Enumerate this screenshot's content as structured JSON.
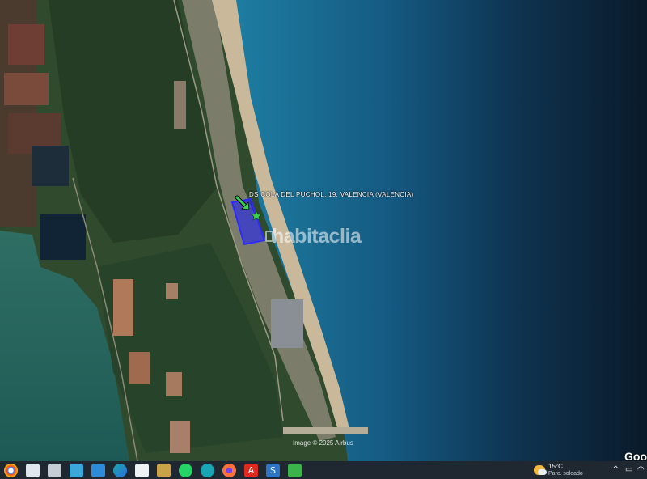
{
  "map": {
    "parcel_label": "DS COLA DEL PUCHOL, 19. VALENCIA (VALENCIA)",
    "watermark": "habitaclia",
    "credit": "Image © 2025 Airbus",
    "provider": "Goo"
  },
  "marker": {
    "icon": "arrow-marker-icon",
    "color": "#39d353"
  },
  "parcel_color": "#1a1aff",
  "taskbar": {
    "apps": [
      {
        "name": "chrome-icon",
        "color": "#e94235"
      },
      {
        "name": "file-manager-icon",
        "color": "#f0c43c"
      },
      {
        "name": "window-icon",
        "color": "#4a90d9"
      },
      {
        "name": "network-icon",
        "color": "#3aa8d8"
      },
      {
        "name": "photos-icon",
        "color": "#2e8bd8"
      },
      {
        "name": "edge-icon",
        "color": "#1aa5a5"
      },
      {
        "name": "document-icon",
        "color": "#d7dde3"
      },
      {
        "name": "archive-icon",
        "color": "#c9a24a"
      },
      {
        "name": "whatsapp-icon",
        "color": "#25d366"
      },
      {
        "name": "browser-icon",
        "color": "#19a5b4"
      },
      {
        "name": "firefox-icon",
        "color": "#ff7139"
      },
      {
        "name": "acrobat-icon",
        "color": "#e02a20"
      },
      {
        "name": "app-s-icon",
        "color": "#2f75c6"
      },
      {
        "name": "app-green-icon",
        "color": "#3bb54a"
      }
    ],
    "weather": {
      "temp": "15°C",
      "condition": "Parc. soleado",
      "icon": "partly-sunny-icon"
    },
    "tray_icons": [
      "chevron-up-icon",
      "monitor-icon",
      "wifi-icon"
    ]
  }
}
